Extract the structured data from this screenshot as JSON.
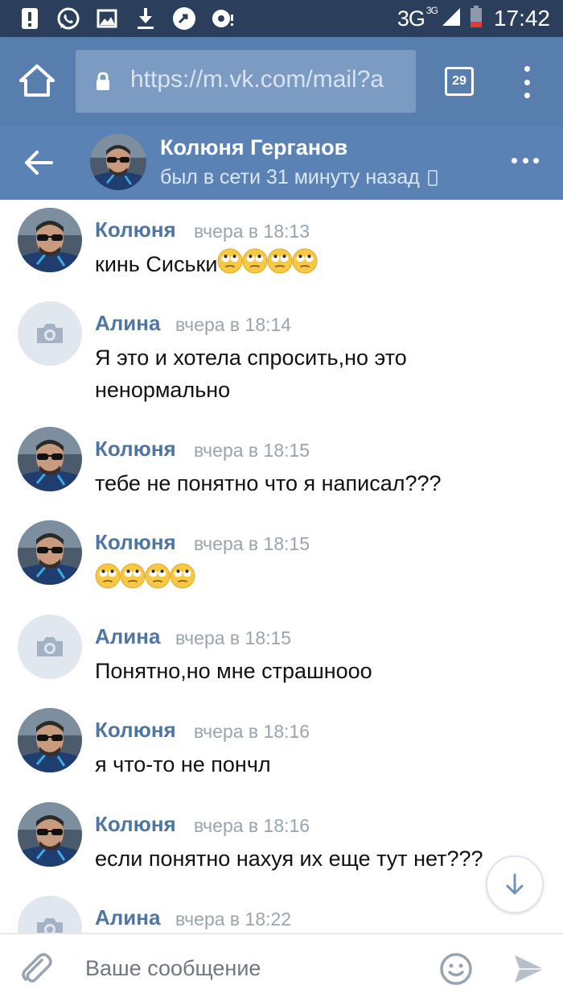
{
  "status_bar": {
    "network": "3G",
    "network_sup": "3G",
    "time": "17:42",
    "left_icons": [
      "alert-icon",
      "whatsapp-icon",
      "image-icon",
      "download-icon",
      "share-icon",
      "clean-icon"
    ]
  },
  "browser": {
    "url": "https://m.vk.com/mail?a",
    "tab_count": "29"
  },
  "chat_header": {
    "name": "Колюня Герганов",
    "status": "был в сети 31 минуту назад"
  },
  "messages": [
    {
      "author": "Колюня",
      "avatar": "photo",
      "time": "вчера в 18:13",
      "text": "кинь Сиськи",
      "emojis": [
        "rolling-eyes",
        "rolling-eyes",
        "rolling-eyes",
        "rolling-eyes"
      ]
    },
    {
      "author": "Алина",
      "avatar": "camera",
      "time": "вчера в 18:14",
      "text": "Я это и хотела спросить,но это ненормально",
      "emojis": []
    },
    {
      "author": "Колюня",
      "avatar": "photo",
      "time": "вчера в 18:15",
      "text": "тебе не понятно что я написал???",
      "emojis": []
    },
    {
      "author": "Колюня",
      "avatar": "photo",
      "time": "вчера в 18:15",
      "text": "",
      "emojis": [
        "rolling-eyes",
        "rolling-eyes",
        "rolling-eyes",
        "rolling-eyes"
      ]
    },
    {
      "author": "Алина",
      "avatar": "camera",
      "time": "вчера в 18:15",
      "text": "Понятно,но мне страшнооо",
      "emojis": []
    },
    {
      "author": "Колюня",
      "avatar": "photo",
      "time": "вчера в 18:16",
      "text": "я что-то не пончл",
      "emojis": []
    },
    {
      "author": "Колюня",
      "avatar": "photo",
      "time": "вчера в 18:16",
      "text": "если понятно нахуя их еще тут нет???",
      "emojis": []
    },
    {
      "author": "Алина",
      "avatar": "camera",
      "time": "вчера в 18:22",
      "text": "",
      "emojis": []
    }
  ],
  "composer": {
    "placeholder": "Ваше сообщение"
  },
  "colors": {
    "status_bar": "#2b3f5c",
    "browser_bar": "#587eae",
    "chat_header": "#5b82b4",
    "author": "#4f75a3",
    "time": "#9aa4ae"
  }
}
